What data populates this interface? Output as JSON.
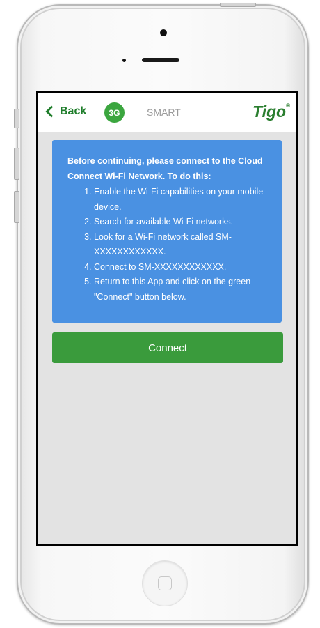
{
  "navbar": {
    "back_label": "Back",
    "network_badge": "3G",
    "title": "SMART",
    "logo_text": "Tigo",
    "logo_mark": "®"
  },
  "info_box": {
    "intro": "Before continuing, please connect to the Cloud Connect Wi-Fi Network. To do this:",
    "steps": [
      "Enable the Wi-Fi capabilities on your mobile device.",
      "Search for available Wi-Fi networks.",
      "Look for a Wi-Fi network called SM-XXXXXXXXXXXX.",
      "Connect to SM-XXXXXXXXXXXX.",
      "Return to this App and click on the green \"Connect\" button below."
    ]
  },
  "connect_button": {
    "label": "Connect"
  },
  "icons": {
    "back": "chevron-left-icon",
    "home": "home-button-icon"
  },
  "colors": {
    "brand_green": "#2a7e2f",
    "button_green": "#3a9b3c",
    "badge_green": "#3ba63f",
    "info_blue": "#4a91e2",
    "screen_bg": "#e3e3e3"
  }
}
